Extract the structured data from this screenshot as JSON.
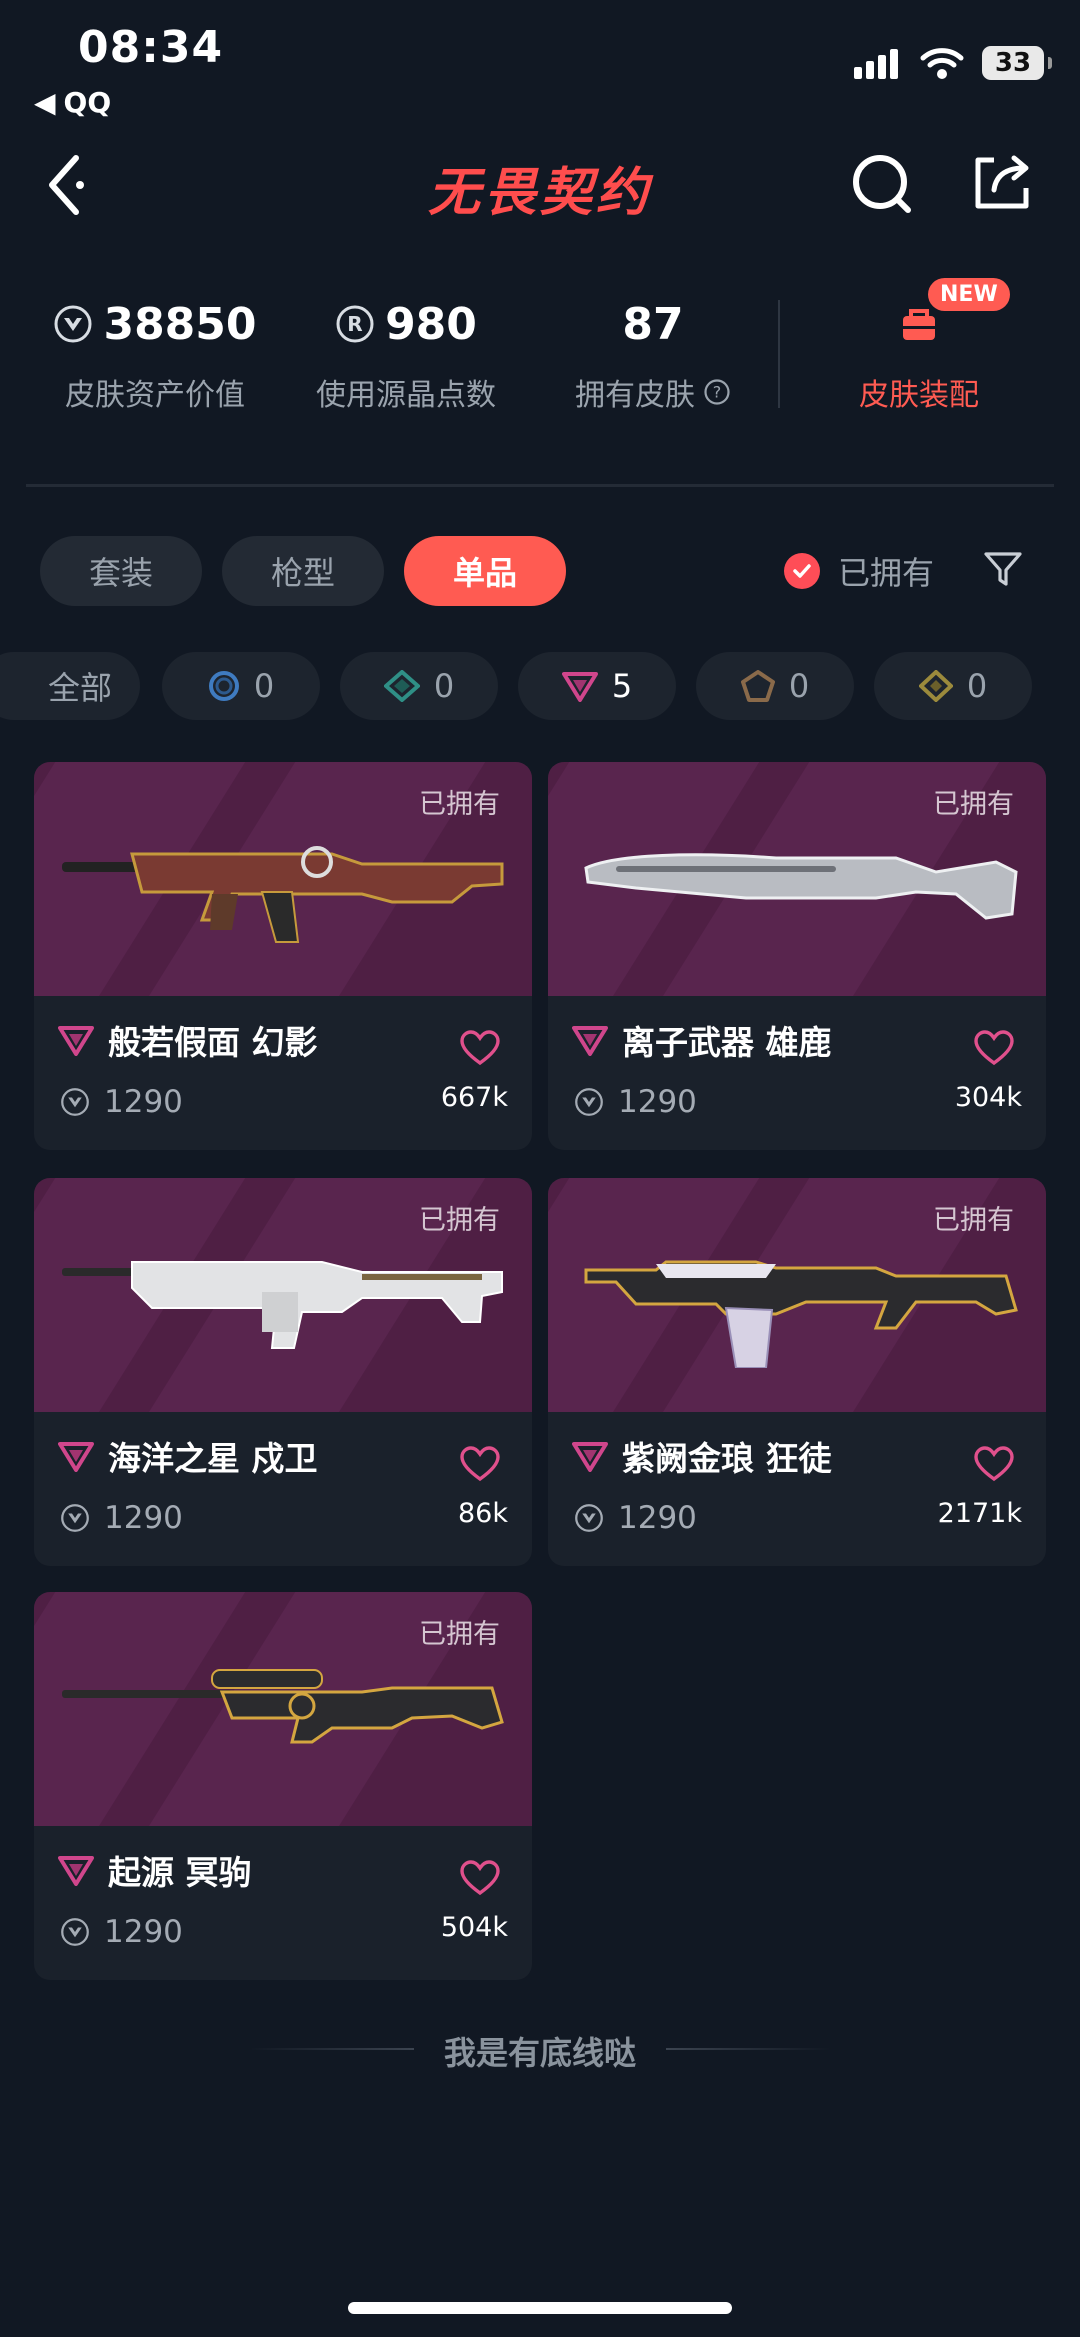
{
  "status_bar": {
    "time": "08:34",
    "back_app": "QQ",
    "battery": "33"
  },
  "header": {
    "logo_text": "无畏契约"
  },
  "stats": [
    {
      "value": "38850",
      "label": "皮肤资产价值",
      "icon": "valorant-points-icon"
    },
    {
      "value": "980",
      "label": "使用源晶点数",
      "icon": "radianite-icon"
    },
    {
      "value": "87",
      "label": "拥有皮肤",
      "icon": "help-icon"
    }
  ],
  "equip": {
    "label": "皮肤装配",
    "badge": "NEW"
  },
  "tabs": [
    {
      "label": "套装",
      "active": false
    },
    {
      "label": "枪型",
      "active": false
    },
    {
      "label": "单品",
      "active": true
    }
  ],
  "owned_filter": {
    "label": "已拥有",
    "checked": true
  },
  "rarity_chips": [
    {
      "label": "全部",
      "count": null
    },
    {
      "icon": "select-tier-icon",
      "count": "0"
    },
    {
      "icon": "deluxe-tier-icon",
      "count": "0"
    },
    {
      "icon": "premium-tier-icon",
      "count": "5",
      "selected": true
    },
    {
      "icon": "exclusive-tier-icon",
      "count": "0"
    },
    {
      "icon": "ultra-tier-icon",
      "count": "0"
    }
  ],
  "skins": [
    {
      "name": "般若假面 幻影",
      "price": "1290",
      "likes": "667k",
      "owned_label": "已拥有",
      "gun": "phantom"
    },
    {
      "name": "离子武器 雄鹿",
      "price": "1290",
      "likes": "304k",
      "owned_label": "已拥有",
      "gun": "bulldog"
    },
    {
      "name": "海洋之星 戍卫",
      "price": "1290",
      "likes": "86k",
      "owned_label": "已拥有",
      "gun": "guardian"
    },
    {
      "name": "紫阙金琅 狂徒",
      "price": "1290",
      "likes": "2171k",
      "owned_label": "已拥有",
      "gun": "vandal"
    },
    {
      "name": "起源 冥驹",
      "price": "1290",
      "likes": "504k",
      "owned_label": "已拥有",
      "gun": "operator"
    }
  ],
  "footer": {
    "end_text": "我是有底线哒"
  },
  "colors": {
    "accent": "#ff5b52",
    "premium": "#d0468c",
    "background": "#111823"
  }
}
